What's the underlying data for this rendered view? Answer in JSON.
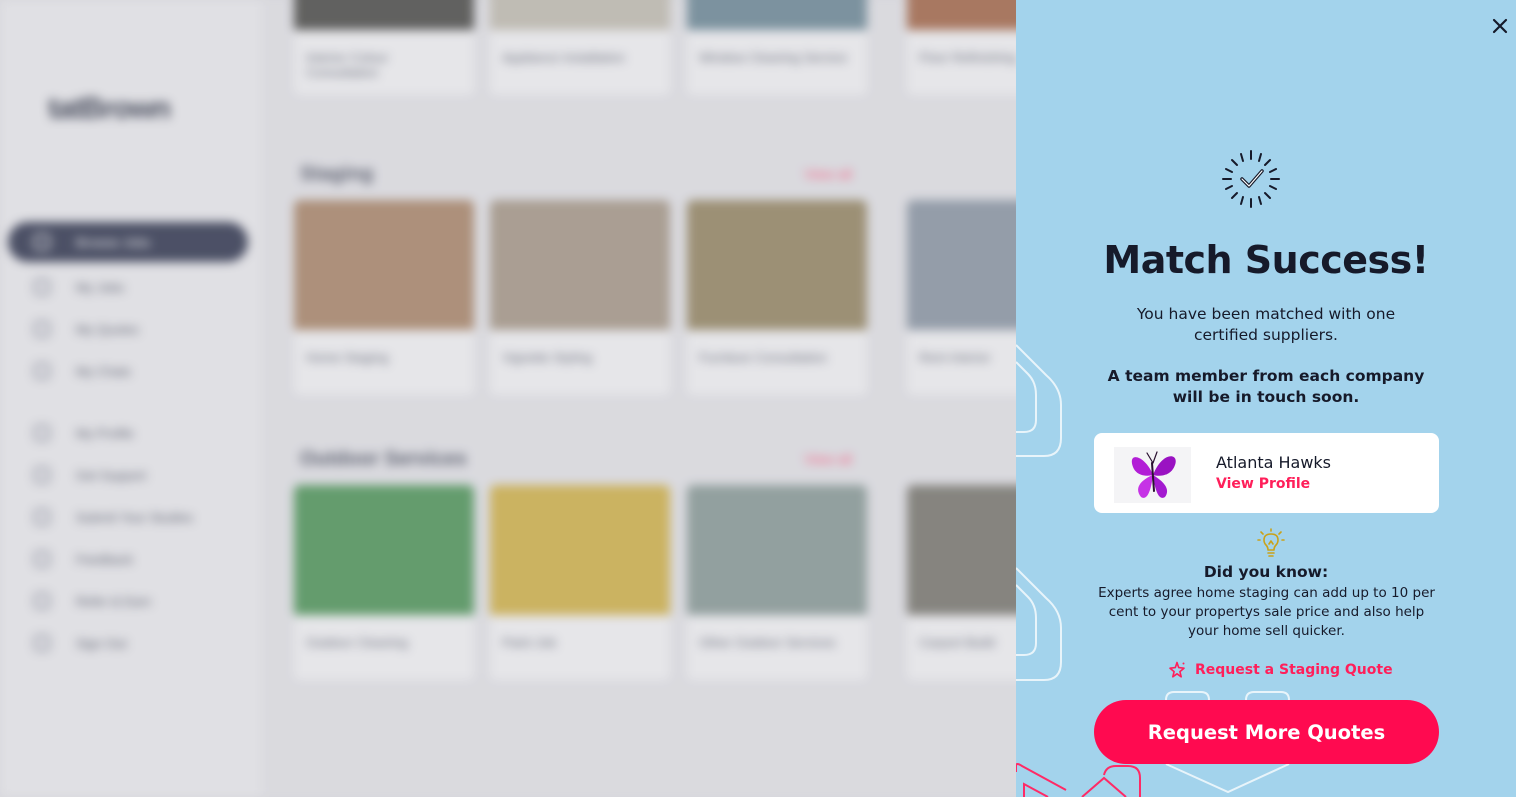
{
  "background": {
    "logo": "tatBrown",
    "sidebar_items": [
      "Browse Jobs",
      "My Jobs",
      "My Quotes",
      "My Chats",
      "My Profile",
      "Get Support",
      "Submit Your Studies",
      "Feedback",
      "Refer & Earn",
      "Sign Out"
    ],
    "sections": [
      {
        "title": "Staging",
        "view_all": "View all",
        "cards": [
          "Home Staging",
          "Vignette Styling",
          "Furniture Consultation",
          "Rent Interior"
        ]
      },
      {
        "title": "Outdoor Services",
        "view_all": "View all",
        "cards": [
          "Outdoor Cleaning",
          "Paint Job",
          "Other Outdoor Services",
          "Carport Build"
        ]
      }
    ],
    "top_cards": [
      "Interior Colour Consultation",
      "Appliance Installation",
      "Window Cleaning Service",
      "Floor Refinishing"
    ]
  },
  "modal": {
    "close_icon": "close-icon",
    "success_icon": "check-burst-icon",
    "title": "Match Success!",
    "subtitle": "You have been matched with one certified suppliers.",
    "notice": "A team member from each company will be in touch soon.",
    "supplier": {
      "name": "Atlanta Hawks",
      "link": "View Profile",
      "logo_icon": "butterfly-logo"
    },
    "did_you_know": {
      "icon": "lightbulb-icon",
      "title": "Did you know:",
      "text": "Experts agree home staging can add up to 10 per cent to your propertys sale price and also help your home sell quicker."
    },
    "staging_link": {
      "icon": "sparkle-icon",
      "label": "Request a Staging Quote"
    },
    "cta_label": "Request More Quotes",
    "colors": {
      "panel_bg": "#a3d3ec",
      "accent": "#ff0a50",
      "text": "#161a2a",
      "deco": "#ff2a66"
    }
  }
}
